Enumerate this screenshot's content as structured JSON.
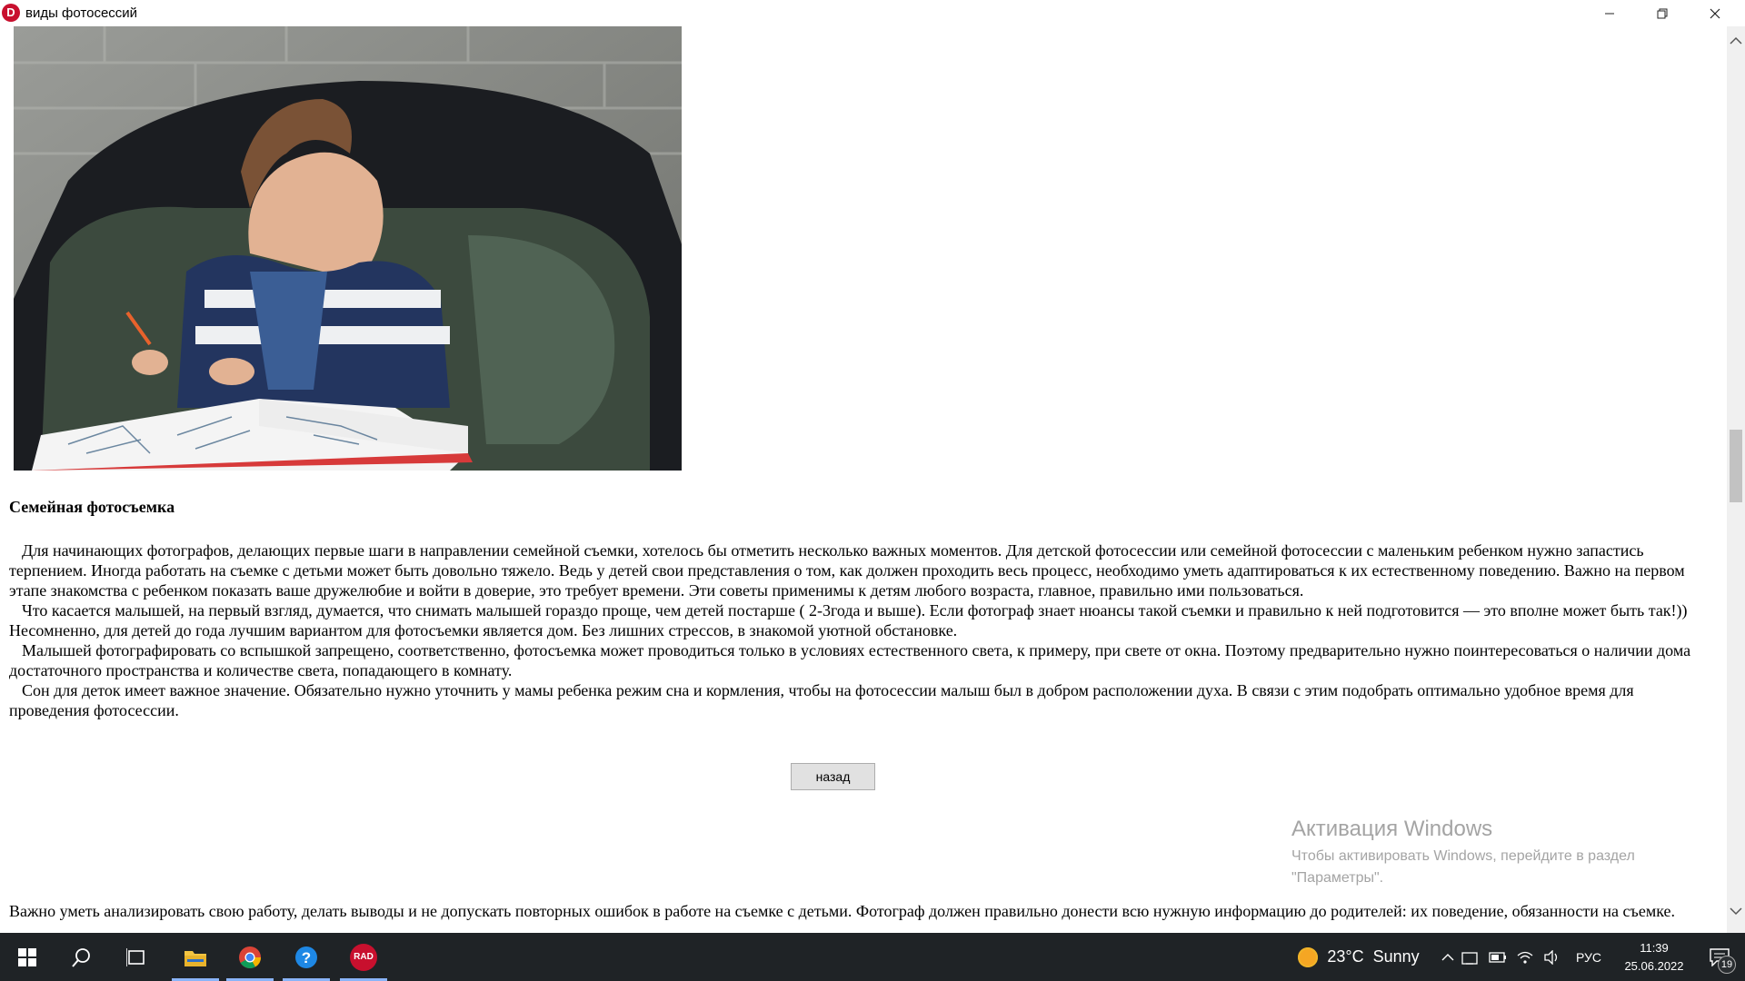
{
  "window": {
    "title": "виды фотосессий",
    "icon": "D"
  },
  "photo": {
    "alt": "Мальчик рисует в раскраске, сидя в кресле"
  },
  "section": {
    "title": "Семейная фотосъемка",
    "paragraphs": [
      "Для начинающих фотографов, делающих первые шаги в направлении семейной съемки, хотелось бы отметить несколько важных моментов. Для детской фотосессии или семейной фотосессии с маленьким ребенком нужно запастись терпением. Иногда работать на съемке с детьми может быть довольно тяжело. Ведь у детей свои представления о том, как должен проходить весь процесс, необходимо уметь адаптироваться к их естественному поведению. Важно на первом этапе знакомства с ребенком показать ваше дружелюбие и войти в доверие, это требует времени. Эти советы применимы к детям любого возраста, главное, правильно ими пользоваться.",
      " Что касается малышей, на первый взгляд, думается, что снимать малышей гораздо проще, чем детей постарше ( 2-3года и выше). Если фотограф знает нюансы такой съемки и правильно к ней подготовится — это вполне может быть так!)) Несомненно, для детей до года лучшим вариантом для фотосъемки является дом. Без лишних стрессов, в знакомой уютной обстановке.",
      "Малышей фотографировать со вспышкой запрещено, соответственно, фотосъемка может проводиться только в условиях естественного света, к примеру, при свете от окна. Поэтому предварительно нужно поинтересоваться о наличии дома достаточного пространства и количестве света, попадающего в комнату.",
      "Сон для деток имеет важное значение. Обязательно нужно уточнить у мамы ребенка режим сна и кормления, чтобы на фотосессии малыш был в добром расположении духа. В связи с этим подобрать оптимально удобное время для проведения фотосессии."
    ]
  },
  "back_button": {
    "label": "назад"
  },
  "activation": {
    "title": "Активация Windows",
    "text": "Чтобы активировать Windows, перейдите в раздел \"Параметры\"."
  },
  "bottom_text": "Важно уметь анализировать свою работу, делать выводы и не допускать повторных ошибок в работе на съемке с детьми. Фотограф должен правильно донести всю нужную информацию до родителей: их поведение, обязанности на съемке.",
  "taskbar": {
    "weather": {
      "temp": "23°C",
      "condition": "Sunny"
    },
    "language": "РУС",
    "time": "11:39",
    "date": "25.06.2022",
    "notifications": "19",
    "apps": [
      "start-icon",
      "search-icon",
      "task-view-icon",
      "file-explorer-icon",
      "chrome-icon",
      "help-icon",
      "rad-studio-icon"
    ],
    "rad_label": "RAD"
  },
  "colors": {
    "taskbar_bg": "#1f2326",
    "icon_red": "#c8102e",
    "activation_text": "#a4a4a4"
  }
}
